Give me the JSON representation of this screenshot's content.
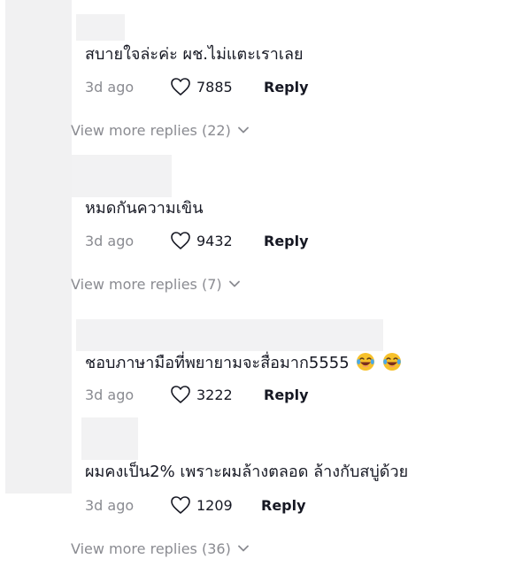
{
  "comments": [
    {
      "text": "สบายใจล่ะค่ะ ผช.ไม่แตะเราเลย",
      "time": "3d ago",
      "likes": "7885",
      "reply_label": "Reply",
      "view_more": "View more replies (22)"
    },
    {
      "text": "หมดกันความเขิน",
      "time": "3d ago",
      "likes": "9432",
      "reply_label": "Reply",
      "view_more": "View more replies (7)"
    },
    {
      "text": "ชอบภาษามือที่พยายามจะสื่อมาก5555",
      "emojis": [
        "laughing-tears-emoji",
        "laughing-tears-emoji"
      ],
      "time": "3d ago",
      "likes": "3222",
      "reply_label": "Reply"
    },
    {
      "text": "ผมคงเป็น2% เพราะผมล้างตลอด ล้างกับสบู่ด้วย",
      "time": "3d ago",
      "likes": "1209",
      "reply_label": "Reply",
      "view_more": "View more replies (36)"
    }
  ],
  "icons": {
    "like": "heart-outline-icon",
    "expand": "chevron-down-icon"
  },
  "colors": {
    "text": "#161823",
    "muted": "#8a8b91",
    "placeholder": "#f1f1f2"
  }
}
